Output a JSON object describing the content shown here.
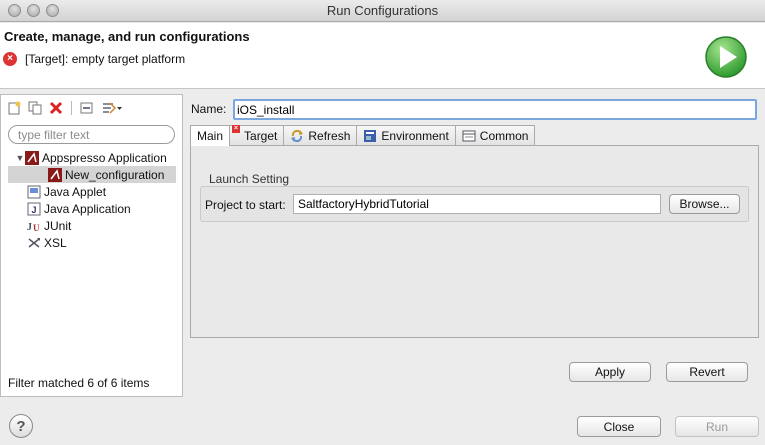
{
  "window": {
    "title": "Run Configurations"
  },
  "header": {
    "title": "Create, manage, and run configurations",
    "message": "[Target]: empty target platform",
    "error_icon": "error-circle-icon",
    "run_icon": "run-play-icon"
  },
  "left_panel": {
    "toolbar": [
      "new-config-icon",
      "duplicate-icon",
      "delete-icon",
      "collapse-all-icon",
      "filter-icon"
    ],
    "filter_placeholder": "type filter text",
    "tree": [
      {
        "label": "Appspresso Application",
        "icon": "appspresso-icon",
        "expanded": true
      },
      {
        "label": "New_configuration",
        "icon": "appspresso-icon",
        "selected": true
      },
      {
        "label": "Java Applet",
        "icon": "java-applet-icon"
      },
      {
        "label": "Java Application",
        "icon": "java-application-icon"
      },
      {
        "label": "JUnit",
        "icon": "junit-icon"
      },
      {
        "label": "XSL",
        "icon": "xsl-icon"
      }
    ],
    "status": "Filter matched 6 of 6 items"
  },
  "right_panel": {
    "name_label": "Name:",
    "name_value": "iOS_install",
    "tabs": [
      {
        "label": "Main",
        "active": true
      },
      {
        "label": "Target",
        "has_error": true
      },
      {
        "label": "Refresh"
      },
      {
        "label": "Environment"
      },
      {
        "label": "Common"
      }
    ],
    "launch_setting": {
      "group_label": "Launch Setting",
      "project_label": "Project to start:",
      "project_value": "SaltfactoryHybridTutorial",
      "browse_label": "Browse..."
    },
    "apply_label": "Apply",
    "revert_label": "Revert"
  },
  "footer": {
    "help_icon": "help-icon",
    "close_label": "Close",
    "run_label": "Run"
  },
  "colors": {
    "accent_focus": "#7aa7e0",
    "error": "#dd3333",
    "run_green": "#3fae3f"
  }
}
